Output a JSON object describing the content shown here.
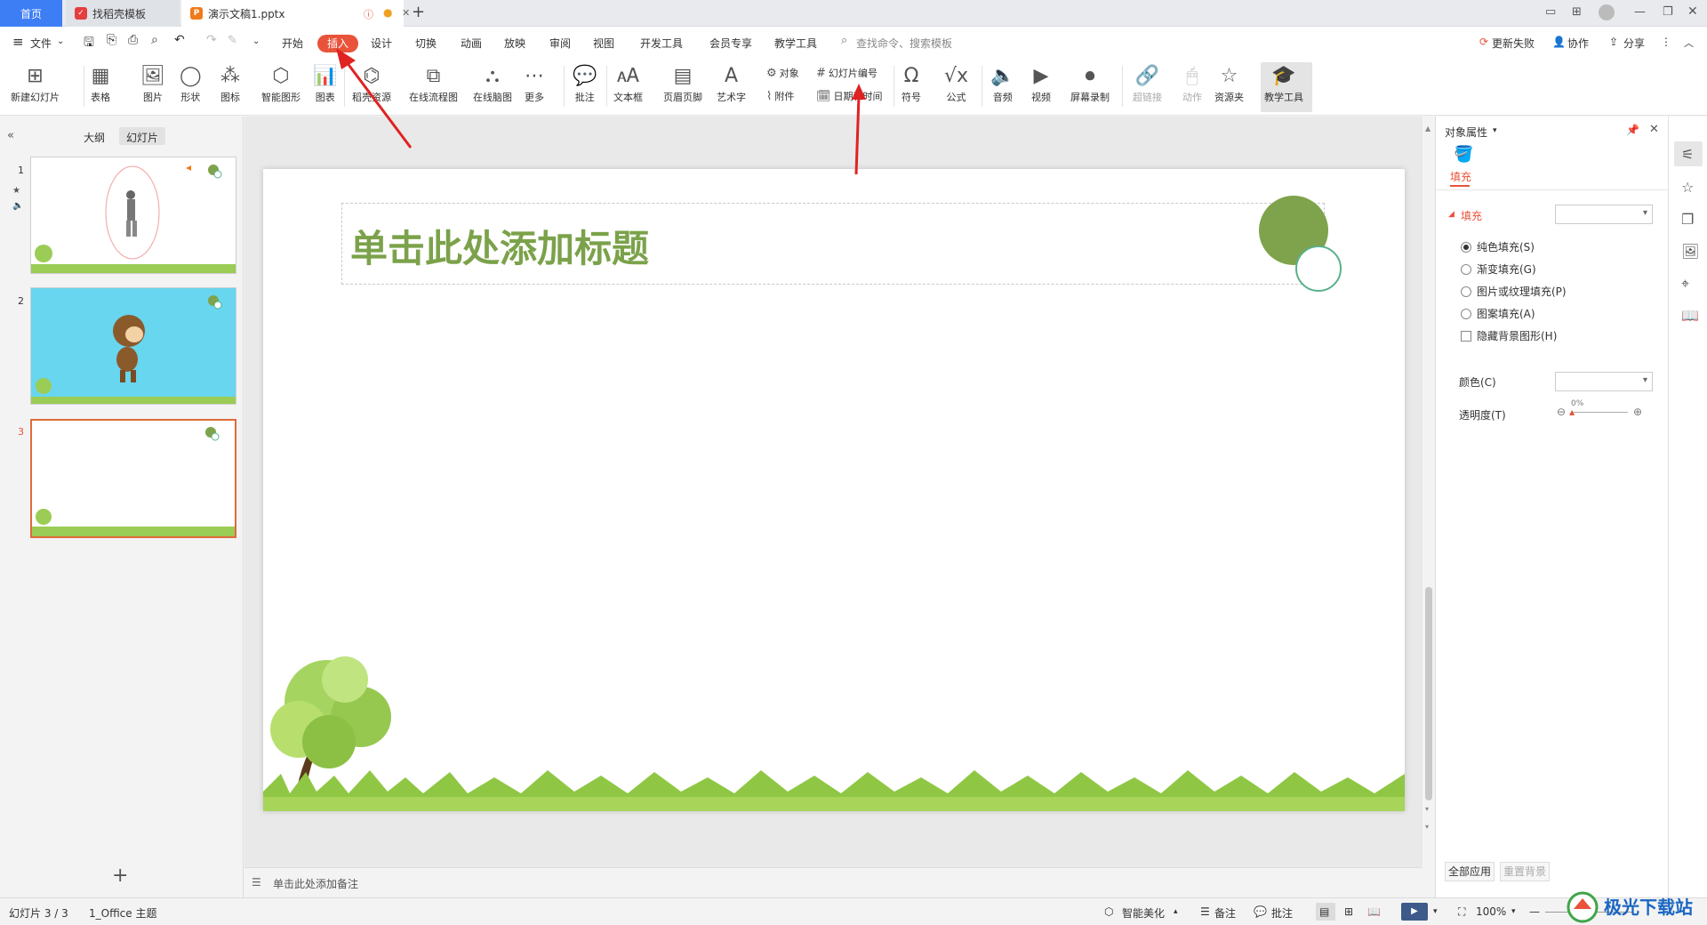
{
  "tabs": {
    "home": "首页",
    "templates": "找稻壳模板",
    "doc": "演示文稿1.pptx"
  },
  "menu": {
    "file": "文件",
    "items": [
      "开始",
      "插入",
      "设计",
      "切换",
      "动画",
      "放映",
      "审阅",
      "视图",
      "开发工具",
      "会员专享",
      "教学工具"
    ],
    "search_placeholder": "查找命令、搜索模板",
    "update_fail": "更新失败",
    "collab": "协作",
    "share": "分享"
  },
  "ribbon": {
    "new_slide": "新建幻灯片",
    "table": "表格",
    "picture": "图片",
    "shape": "形状",
    "icon": "图标",
    "smart": "智能图形",
    "chart": "图表",
    "daoke": "稻壳资源",
    "flow": "在线流程图",
    "mind": "在线脑图",
    "more": "更多",
    "comment": "批注",
    "textbox": "文本框",
    "header_footer": "页眉页脚",
    "wordart": "艺术字",
    "object": "对象",
    "attach": "附件",
    "slide_num": "幻灯片编号",
    "datetime": "日期和时间",
    "symbol": "符号",
    "formula": "公式",
    "audio": "音频",
    "video": "视频",
    "screen_rec": "屏幕录制",
    "hyperlink": "超链接",
    "action": "动作",
    "resource": "资源夹",
    "teach": "教学工具"
  },
  "left_panel": {
    "outline": "大纲",
    "slides": "幻灯片",
    "numbers": [
      "1",
      "2",
      "3"
    ]
  },
  "slide": {
    "title_placeholder": "单击此处添加标题"
  },
  "notes_placeholder": "单击此处添加备注",
  "right_panel": {
    "title": "对象属性",
    "tab_fill": "填充",
    "section_fill": "填充",
    "options": [
      "纯色填充(S)",
      "渐变填充(G)",
      "图片或纹理填充(P)",
      "图案填充(A)"
    ],
    "hide_bg": "隐藏背景图形(H)",
    "color_label": "颜色(C)",
    "transparency_label": "透明度(T)",
    "transparency_value": "0%",
    "apply_all": "全部应用",
    "reset_bg": "重置背景"
  },
  "status": {
    "slide_count": "幻灯片 3 / 3",
    "theme": "1_Office 主题",
    "beautify": "智能美化",
    "notes": "备注",
    "comments": "批注",
    "zoom": "100%"
  },
  "watermark": "极光下载站",
  "colors": {
    "accent": "#e8533a",
    "title_green": "#7ba24a",
    "slide2_bg": "#67d6ee",
    "circle_green": "#7ea34c"
  }
}
